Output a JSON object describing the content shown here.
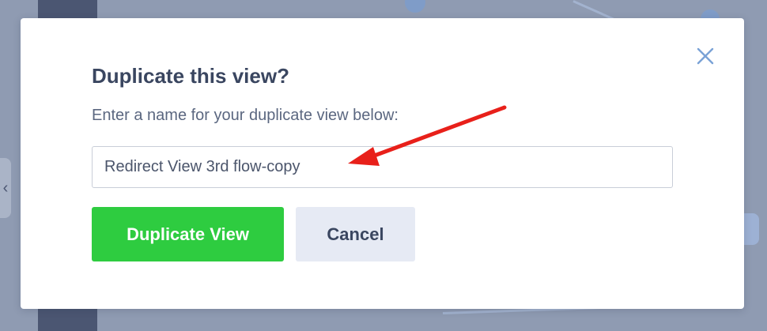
{
  "dialog": {
    "title": "Duplicate this view?",
    "prompt": "Enter a name for your duplicate view below:",
    "name_input": {
      "value": "Redirect View 3rd flow-copy",
      "placeholder": ""
    },
    "primary_button": "Duplicate View",
    "secondary_button": "Cancel",
    "close_icon": "close-icon"
  },
  "sidebar_edge": {
    "icon": "chevron-left-icon",
    "glyph": "‹"
  },
  "annotation": {
    "icon": "red-arrow-icon",
    "color": "#e8201a"
  },
  "colors": {
    "primary": "#2ecc40",
    "secondary": "#e6eaf4",
    "title": "#3a4660",
    "close": "#7aa2d6",
    "backdrop": "#8f9bb2"
  }
}
